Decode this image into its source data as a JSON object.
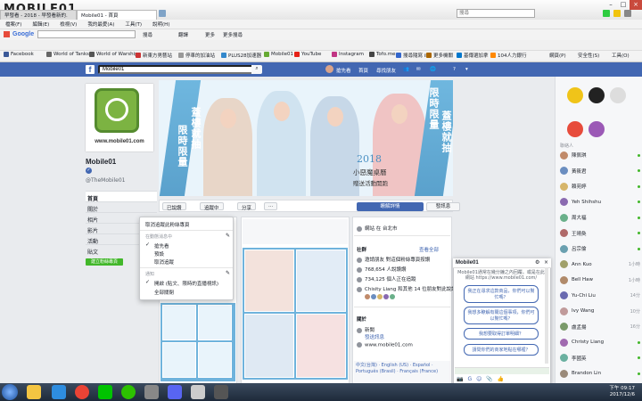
{
  "browser": {
    "brand": "MOBILE01",
    "tabs": [
      "早發看 - 2018 - 早發看新的.",
      "Mobile01 - 首頁"
    ],
    "address_placeholder": "搜尋",
    "menu": [
      "檔案(F)",
      "編輯(E)",
      "檢視(V)",
      "我的最愛(A)",
      "工具(T)",
      "說明(H)"
    ],
    "search_label": "Google",
    "toolbar_items": [
      "搜尋",
      "翻譯",
      "更多",
      "更多搜尋"
    ],
    "bookmarks": [
      {
        "label": "Facebook",
        "color": "#3b5998"
      },
      {
        "label": "World of Tanks",
        "color": "#666666"
      },
      {
        "label": "World of Warships",
        "color": "#555555"
      },
      {
        "label": "新東方男藝站",
        "color": "#cc3333"
      },
      {
        "label": "停車的加油站",
        "color": "#999999"
      },
      {
        "label": "PLUS28加速器",
        "color": "#3388cc"
      },
      {
        "label": "Mobile01",
        "color": "#66aa33"
      },
      {
        "label": "YouTube",
        "color": "#e62117"
      },
      {
        "label": "Instagram",
        "color": "#c13584"
      },
      {
        "label": "Tofo.me",
        "color": "#444444"
      },
      {
        "label": "搜尋隨寫 iKF",
        "color": "#3366cc"
      },
      {
        "label": "更多機關",
        "color": "#aa6600"
      },
      {
        "label": "基傳選加拿",
        "color": "#0077cc"
      },
      {
        "label": "104人力銀行",
        "color": "#ff8800"
      }
    ],
    "right_tools": [
      "網頁(P)",
      "安全性(S)",
      "工具(O)"
    ]
  },
  "fb": {
    "search_value": "Mobile01",
    "nav": [
      "搶先看",
      "首頁",
      "尋找朋友"
    ],
    "colors": {
      "bar": "#4267b2",
      "green": "#42b72a"
    }
  },
  "page": {
    "name": "Mobile01",
    "handle": "@TheMobile01",
    "url": "www.mobile01.com",
    "side_items": [
      "首頁",
      "關於",
      "相片",
      "影片",
      "活動",
      "貼文",
      "社群"
    ],
    "shop_button": "建立粉絲專頁"
  },
  "cover": {
    "left_text_1": "限時限量",
    "left_text_2": "蓋樓就抽",
    "right_text_1": "限時限量",
    "right_text_2": "蓋樓就抽",
    "year": "2018",
    "title": "小惡魔桌曆",
    "subtitle": "贈送活動開跑"
  },
  "actions": {
    "liked": "已說讚",
    "following": "追蹤中",
    "share": "分享",
    "more": "···",
    "more_info": "瞭解詳情",
    "send_message": "發訊息"
  },
  "dropdown": {
    "top_item": "取消追蹤此粉絲專頁",
    "section1": "在動態消息中",
    "items1": [
      "搶先看",
      "預設",
      "取消追蹤"
    ],
    "section2": "通知",
    "items2": [
      "開啟 (貼文、限時的直播視訊)",
      "全部關閉"
    ]
  },
  "info": {
    "location": "網站 在 台北市",
    "community_title": "社群",
    "see_all": "查看全部",
    "invite": "邀請朋友 對這個粉絲專頁按讚",
    "likes": "768,654 人說讚讚",
    "followers": "734,125 個人正在追蹤",
    "friends": "Chisity Liang 和其他 14 位朋友對此說讚",
    "about_title": "關於",
    "type": "新聞",
    "type_sub": "發送訊息",
    "website": "www.mobile01.com",
    "languages": "中文(台灣) · English (US) · Español · Português (Brasil) · Français (France)"
  },
  "messenger": {
    "title": "Mobile01",
    "intro": "Mobile01通常在幾分鐘之內回覆。或是在此網站 https://www.mobile01.com/",
    "quick_replies": [
      "我正在尋求這款商品，你們可以幫忙嗎？",
      "我想多瞭解有關這個事項，你們可以幫忙嗎？",
      "我想要取得訂單明細？",
      "請問你們的商家地點在哪裡？"
    ]
  },
  "chat": {
    "section": "聯絡人",
    "contacts": [
      {
        "name": "陳佩琪",
        "status": "online"
      },
      {
        "name": "黃筱君",
        "status": "online"
      },
      {
        "name": "賴苑婷",
        "status": "online"
      },
      {
        "name": "Yeh Shihshu",
        "status": "online"
      },
      {
        "name": "周大福",
        "status": "online"
      },
      {
        "name": "王晴奐",
        "status": "online"
      },
      {
        "name": "呂宗倫",
        "status": "online"
      },
      {
        "name": "Ann Kuo",
        "status": "1小時"
      },
      {
        "name": "Bell Haw",
        "status": "1小時"
      },
      {
        "name": "Yu-Chi Liu",
        "status": "14分"
      },
      {
        "name": "Ivy Wang",
        "status": "10分"
      },
      {
        "name": "盧孟揚",
        "status": "16分"
      },
      {
        "name": "Christy Liang",
        "status": "online"
      },
      {
        "name": "李國英",
        "status": "online"
      },
      {
        "name": "Brandon Lin",
        "status": "online"
      }
    ]
  },
  "taskbar": {
    "time": "下午 09:17",
    "date": "2017/12/6"
  }
}
